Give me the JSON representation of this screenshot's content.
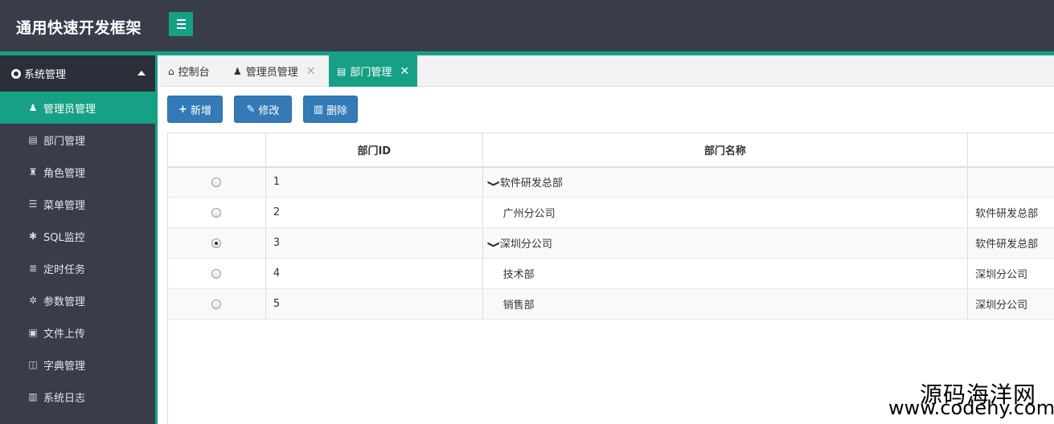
{
  "header": {
    "brand": "通用快速开发框架",
    "menu_icon": "hamburger-icon"
  },
  "sidebar": {
    "group": {
      "label": "系统管理",
      "icon": "gear-icon"
    },
    "items": [
      {
        "label": "管理员管理",
        "icon": "user-icon",
        "glyph": "♟",
        "active": true
      },
      {
        "label": "部门管理",
        "icon": "document-icon",
        "glyph": "▤"
      },
      {
        "label": "角色管理",
        "icon": "user-secret-icon",
        "glyph": "♜"
      },
      {
        "label": "菜单管理",
        "icon": "list-icon",
        "glyph": "☰"
      },
      {
        "label": "SQL监控",
        "icon": "bug-icon",
        "glyph": "✱"
      },
      {
        "label": "定时任务",
        "icon": "tasks-icon",
        "glyph": "≣"
      },
      {
        "label": "参数管理",
        "icon": "cog-icon",
        "glyph": "✲"
      },
      {
        "label": "文件上传",
        "icon": "image-file-icon",
        "glyph": "▣"
      },
      {
        "label": "字典管理",
        "icon": "bookmark-icon",
        "glyph": "◫"
      },
      {
        "label": "系统日志",
        "icon": "file-text-icon",
        "glyph": "▥"
      }
    ]
  },
  "tabs": [
    {
      "label": "控制台",
      "icon": "home-icon",
      "glyph": "⌂"
    },
    {
      "label": "管理员管理",
      "icon": "user-icon",
      "glyph": "♟",
      "close": "✕"
    },
    {
      "label": "部门管理",
      "icon": "document-icon",
      "glyph": "▤",
      "close": "✕",
      "active": true
    }
  ],
  "toolbar": {
    "add": {
      "label": "新增",
      "glyph": "+"
    },
    "edit": {
      "label": "修改",
      "glyph": "✎"
    },
    "delete": {
      "label": "删除",
      "glyph": "▥"
    }
  },
  "table": {
    "columns": [
      "",
      "部门ID",
      "部门名称",
      ""
    ],
    "rows": [
      {
        "id": "1",
        "name": "软件研发总部",
        "parent": "",
        "level": 0,
        "expanded": true,
        "checked": false
      },
      {
        "id": "2",
        "name": "广州分公司",
        "parent": "软件研发总部",
        "level": 1,
        "expanded": false,
        "checked": false
      },
      {
        "id": "3",
        "name": "深圳分公司",
        "parent": "软件研发总部",
        "level": 1,
        "expanded": true,
        "checked": true
      },
      {
        "id": "4",
        "name": "技术部",
        "parent": "深圳分公司",
        "level": 2,
        "expanded": false,
        "checked": false
      },
      {
        "id": "5",
        "name": "销售部",
        "parent": "深圳分公司",
        "level": 2,
        "expanded": false,
        "checked": false
      }
    ],
    "expand_glyph": "❯"
  },
  "watermark": {
    "title": "源码海洋网",
    "url": "www.codehy.com"
  },
  "colors": {
    "header": "#393d49",
    "accent": "#16a085",
    "button": "#337ab7"
  }
}
